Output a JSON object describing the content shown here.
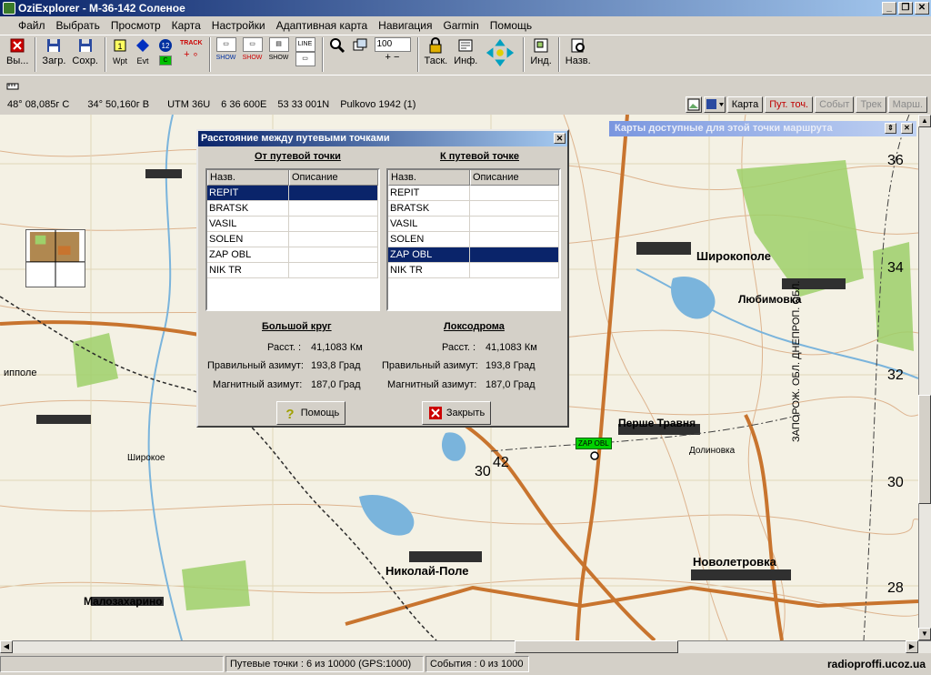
{
  "window": {
    "title": "OziExplorer - M-36-142 Соленое",
    "controls": [
      "_",
      "❐",
      "✕"
    ]
  },
  "menu": [
    "Файл",
    "Выбрать",
    "Просмотр",
    "Карта",
    "Настройки",
    "Адаптивная карта",
    "Навигация",
    "Garmin",
    "Помощь"
  ],
  "toolbar": {
    "exit": "Вы...",
    "load": "Загр.",
    "save": "Сохр.",
    "wpt": "Wpt",
    "evt": "Evt",
    "track": "TRACK",
    "show1": "SHOW",
    "show2": "SHOW",
    "show3": "SHOW",
    "line": "LINE",
    "zoom": "100",
    "task": "Таск.",
    "info": "Инф.",
    "ind": "Инд.",
    "name": "Назв."
  },
  "coords": {
    "lat": "48° 08,085г С",
    "lon": "34° 50,160г В",
    "utm_zone": "UTM  36U",
    "easting": "6 36 600E",
    "northing": "53 33 001N",
    "datum": "Pulkovo 1942 (1)"
  },
  "view_tabs": [
    {
      "label": "Карта",
      "state": "normal"
    },
    {
      "label": "Пут. точ.",
      "state": "active"
    },
    {
      "label": "Событ",
      "state": "disabled"
    },
    {
      "label": "Трек",
      "state": "disabled"
    },
    {
      "label": "Марш.",
      "state": "disabled"
    }
  ],
  "maps_panel": {
    "title": "Карты доступные для этой точки маршрута"
  },
  "dialog": {
    "title": "Расстояние между путевыми точками",
    "from_heading": "От путевой точки",
    "to_heading": "К путевой точке",
    "col_name": "Назв.",
    "col_desc": "Описание",
    "from_list": [
      {
        "name": "REPIT",
        "selected": true
      },
      {
        "name": "BRATSK"
      },
      {
        "name": "VASIL"
      },
      {
        "name": "SOLEN"
      },
      {
        "name": "ZAP OBL"
      },
      {
        "name": "NIK TR"
      }
    ],
    "to_list": [
      {
        "name": "REPIT"
      },
      {
        "name": "BRATSK"
      },
      {
        "name": "VASIL"
      },
      {
        "name": "SOLEN"
      },
      {
        "name": "ZAP OBL",
        "selected": true
      },
      {
        "name": "NIK TR"
      }
    ],
    "great_circle": {
      "heading": "Большой круг",
      "dist_label": "Расст. :",
      "dist": "41,1083 Км",
      "true_label": "Правильный азимут:",
      "true_az": "193,8 Град",
      "mag_label": "Магнитный азимут:",
      "mag_az": "187,0 Град"
    },
    "rhumb": {
      "heading": "Локсодрома",
      "dist_label": "Расст. :",
      "dist": "41,1083 Км",
      "true_label": "Правильный азимут:",
      "true_az": "193,8 Град",
      "mag_label": "Магнитный азимут:",
      "mag_az": "187,0 Град"
    },
    "help_button": "Помощь",
    "close_button": "Закрыть"
  },
  "map": {
    "grid_labels_right": [
      "36",
      "34",
      "32",
      "30",
      "28"
    ],
    "grid_labels_bottom": [
      "42",
      "30"
    ],
    "places": [
      {
        "t": "Широкополе",
        "s": "big"
      },
      {
        "t": "Любимовка",
        "s": "big"
      },
      {
        "t": "Перше Травня",
        "s": "big"
      },
      {
        "t": "Новолетровка",
        "s": "big"
      },
      {
        "t": "Николай-Поле",
        "s": "big"
      },
      {
        "t": "Малозахарино",
        "s": "big"
      },
      {
        "t": "Долиновка",
        "s": "small"
      },
      {
        "t": "Широкое",
        "s": "small"
      },
      {
        "t": "ипполе",
        "s": "small"
      },
      {
        "t": "ЗАПОРОЖ. ОБЛ.  ДНЕПРОП. ОБЛ.",
        "s": "border"
      }
    ],
    "waypoint_label": "ZAP OBL",
    "colors": {
      "paper": "#f4f1e4",
      "road": "#c8742e",
      "water": "#7ab4dc",
      "forest": "#9ed06a",
      "contour": "#d49a6a"
    }
  },
  "status": {
    "waypoints": "Путевые точки : 6 из 10000  (GPS:1000)",
    "events": "События : 0 из 1000",
    "site": "radioproffi.ucoz.ua"
  }
}
